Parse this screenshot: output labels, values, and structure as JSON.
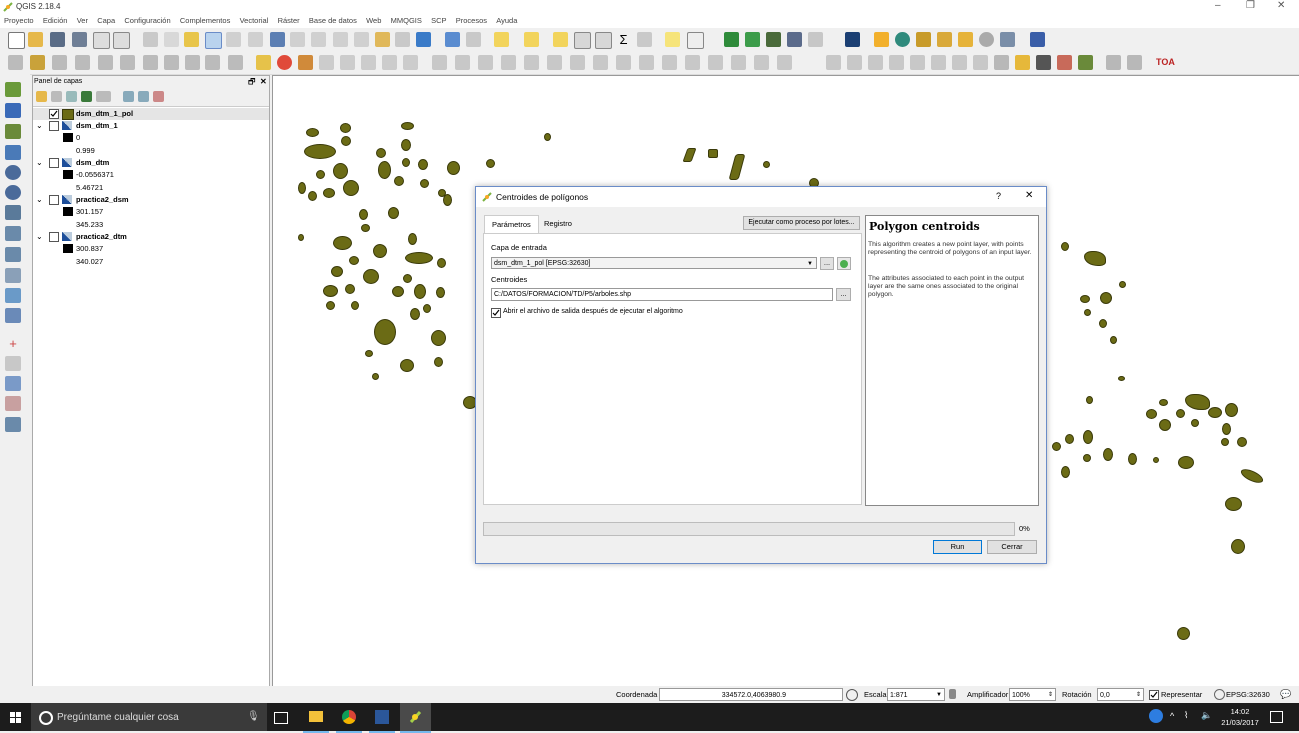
{
  "window": {
    "title": "QGIS 2.18.4"
  },
  "menu": [
    "Proyecto",
    "Edición",
    "Ver",
    "Capa",
    "Configuración",
    "Complementos",
    "Vectorial",
    "Ráster",
    "Base de datos",
    "Web",
    "MMQGIS",
    "SCP",
    "Procesos",
    "Ayuda"
  ],
  "panel": {
    "title": "Panel de capas",
    "layers": [
      {
        "name": "dsm_dtm_1_pol",
        "checked": true,
        "bold": true
      },
      {
        "name": "dsm_dtm_1",
        "min": "0",
        "max": "0.999"
      },
      {
        "name": "dsm_dtm",
        "min": "-0.0556371",
        "max": "5.46721"
      },
      {
        "name": "practica2_dsm",
        "min": "301.157",
        "max": "345.233"
      },
      {
        "name": "practica2_dtm",
        "min": "300.837",
        "max": "340.027"
      }
    ]
  },
  "dialog": {
    "title": "Centroides de polígonos",
    "help_btn": "?",
    "close_btn": "✕",
    "tabs": [
      "Parámetros",
      "Registro"
    ],
    "batch_button": "Ejecutar como proceso por lotes...",
    "input_label": "Capa de entrada",
    "input_value": "dsm_dtm_1_pol [EPSG:32630]",
    "output_label": "Centroides",
    "output_value": "C:/DATOS/FORMACION/TD/P5/arboles.shp",
    "browse": "...",
    "open_output_label": "Abrir el archivo de salida después de ejecutar el algoritmo",
    "progress": 0,
    "progress_label": "0%",
    "run": "Run",
    "close": "Cerrar",
    "help_title": "Polygon centroids",
    "help_p1": "This algorithm creates a new point layer, with points representing the centroid of polygons of an input layer.",
    "help_p2": "The attributes associated to each point in the output layer are the same ones associated to the original polygon."
  },
  "status": {
    "coord_label": "Coordenada",
    "coord_value": "334572.0,4063980.9",
    "scale_label": "Escala",
    "scale_value": "1:871",
    "magnifier_label": "Amplificador",
    "magnifier_value": "100%",
    "rotation_label": "Rotación",
    "rotation_value": "0,0",
    "render_label": "Representar",
    "crs": "EPSG:32630"
  },
  "taskbar": {
    "search_placeholder": "Pregúntame cualquier cosa",
    "time": "14:02",
    "date": "21/03/2017"
  },
  "colors": {
    "polygon_fill": "#6b6b15",
    "accent": "#0078d7"
  }
}
